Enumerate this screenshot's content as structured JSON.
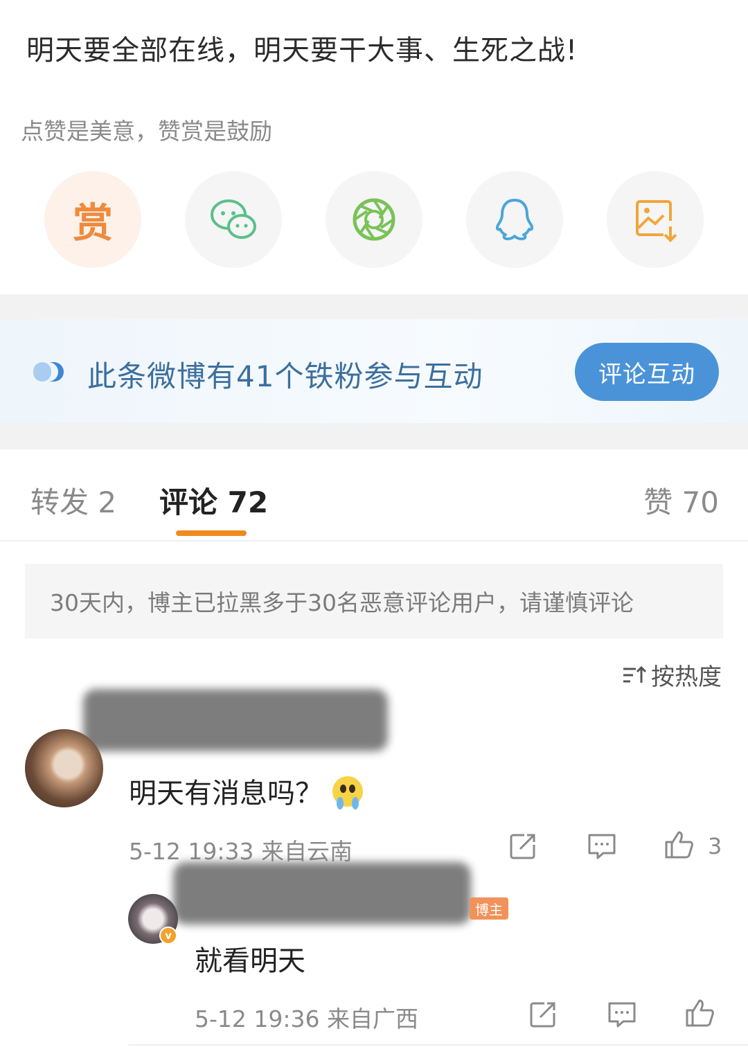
{
  "post": {
    "text": "明天要全部在线，明天要干大事、生死之战!",
    "reward_hint": "点赞是美意，赞赏是鼓励",
    "reward_label": "赏"
  },
  "share_buttons": [
    {
      "name": "reward",
      "icon": "reward-icon"
    },
    {
      "name": "wechat",
      "icon": "wechat-icon"
    },
    {
      "name": "moments",
      "icon": "moments-icon"
    },
    {
      "name": "qq",
      "icon": "qq-icon"
    },
    {
      "name": "save-image",
      "icon": "save-image-icon"
    }
  ],
  "fans_banner": {
    "text": "此条微博有41个铁粉参与互动",
    "button": "评论互动"
  },
  "tabs": {
    "repost": "转发 2",
    "comment": "评论 72",
    "like": "赞 70"
  },
  "notice": "30天内，博主已拉黑多于30名恶意评论用户，请谨慎评论",
  "sort_label": "按热度",
  "comments": [
    {
      "text": "明天有消息吗？",
      "meta": "5-12 19:33  来自云南",
      "likes": "3"
    },
    {
      "badge": "博主",
      "text": "就看明天",
      "meta": "5-12 19:36  来自广西"
    }
  ],
  "colors": {
    "accent": "#f08a1c",
    "link_blue": "#4b93d8",
    "reward_orange": "#f08a3c"
  }
}
